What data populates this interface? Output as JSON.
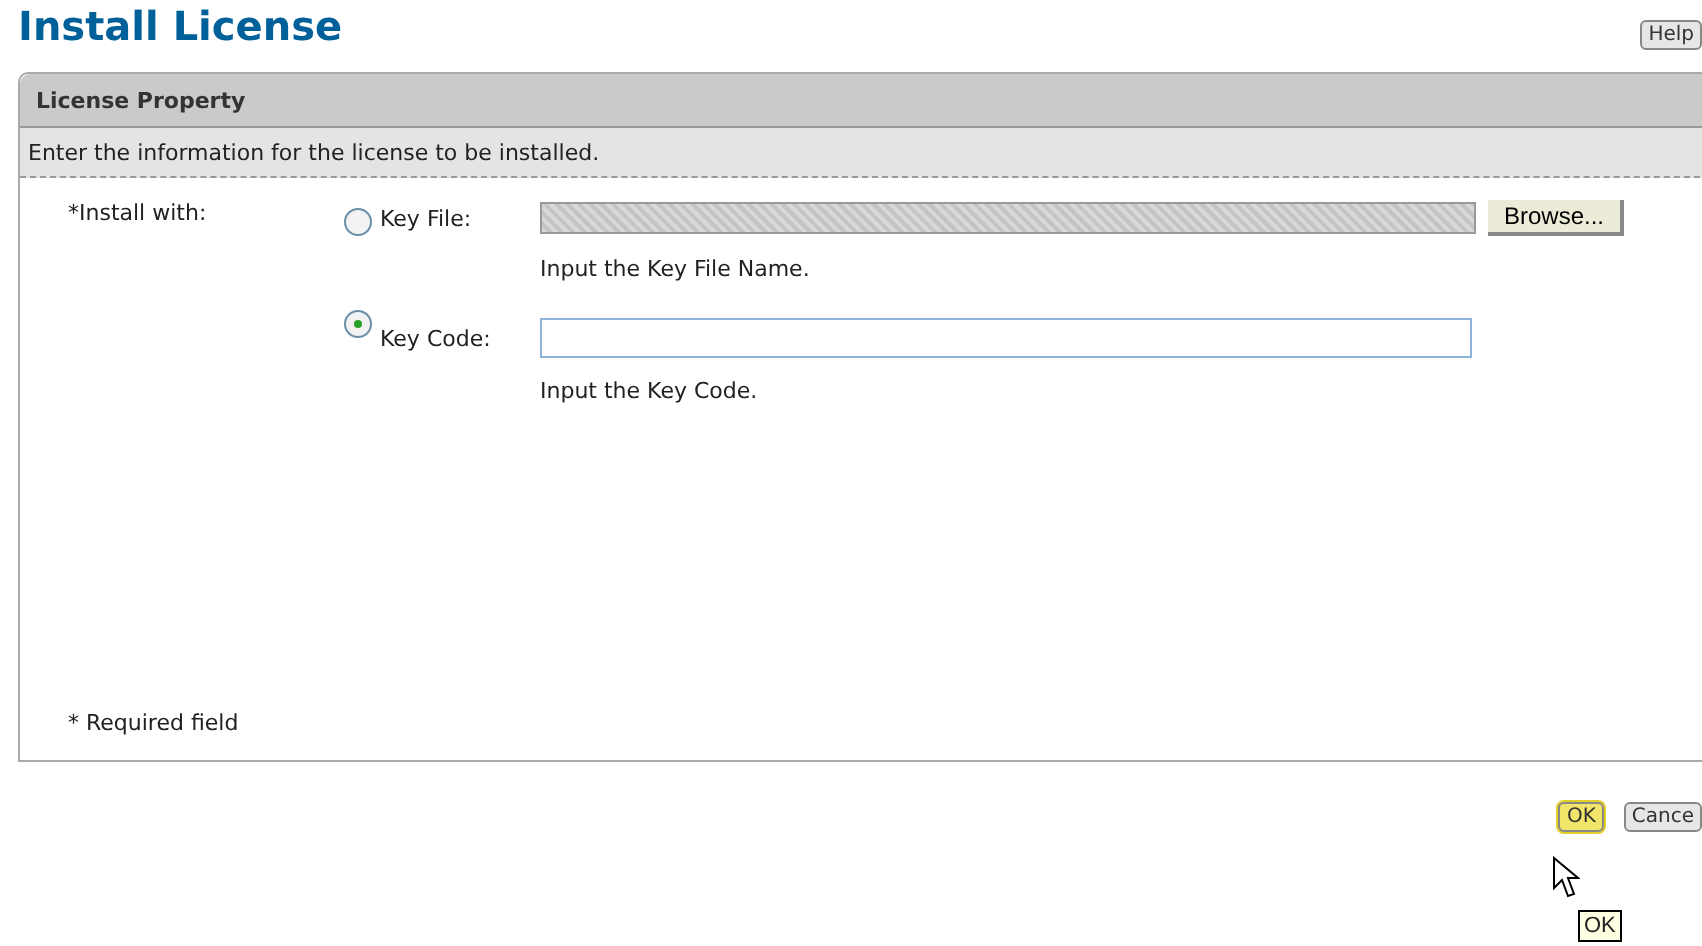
{
  "page": {
    "title": "Install License",
    "help_button": "Help"
  },
  "panel": {
    "title": "License Property",
    "description": "Enter the information for the license to be installed."
  },
  "form": {
    "label": "*Install with:",
    "options": [
      {
        "kind": "file",
        "label": "Key File:",
        "selected": false,
        "hint": "Input the Key File Name.",
        "button": "Browse..."
      },
      {
        "kind": "code",
        "label": "Key Code:",
        "selected": true,
        "hint": "Input the Key Code."
      }
    ],
    "required_note": "* Required field"
  },
  "buttons": [
    {
      "label": "OK",
      "highlighted": true
    },
    {
      "label": "Cance",
      "highlighted": false
    }
  ],
  "tooltip": "OK"
}
